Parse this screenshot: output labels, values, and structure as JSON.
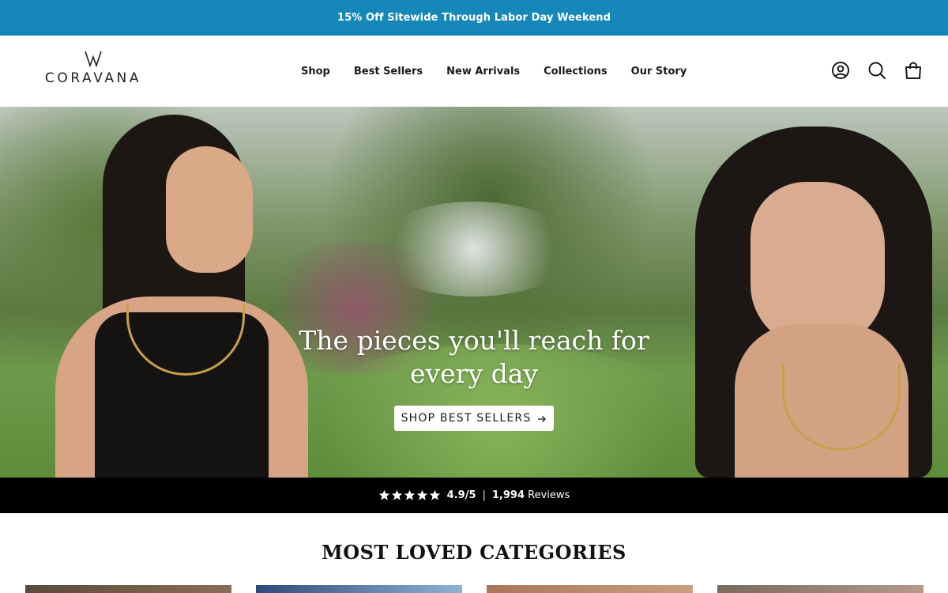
{
  "announcement": {
    "text": "15% Off Sitewide Through Labor Day Weekend"
  },
  "brand": {
    "name": "CORAVANA"
  },
  "nav": {
    "items": [
      {
        "label": "Shop"
      },
      {
        "label": "Best Sellers"
      },
      {
        "label": "New Arrivals"
      },
      {
        "label": "Collections"
      },
      {
        "label": "Our Story"
      }
    ]
  },
  "header_icons": [
    "account-icon",
    "search-icon",
    "cart-icon"
  ],
  "hero": {
    "title_line1": "The pieces you'll reach for",
    "title_line2": "every day",
    "cta_label": "SHOP BEST SELLERS",
    "cta_icon": "arrow-right-icon"
  },
  "reviews": {
    "stars": 5,
    "rating": "4.9/5",
    "separator": "|",
    "count": "1,994",
    "count_label": "Reviews"
  },
  "categories": {
    "title": "MOST LOVED CATEGORIES"
  },
  "colors": {
    "announcement_bg": "#1587b8",
    "reviews_bar_bg": "#000000"
  }
}
